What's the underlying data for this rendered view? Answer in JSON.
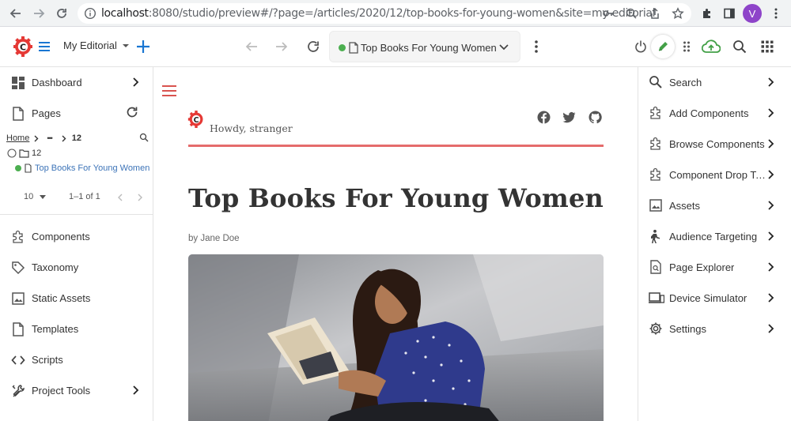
{
  "browser": {
    "url_host": "localhost",
    "url_path": ":8080/studio/preview#/?page=/articles/2020/12/top-books-for-young-women&site=my-editorial",
    "profile_initial": "V",
    "icons": [
      "back-arrow-icon",
      "forward-arrow-icon",
      "refresh-icon",
      "info-icon",
      "key-icon",
      "zoom-icon",
      "share-icon",
      "star-icon",
      "extensions-icon",
      "sidebar-icon"
    ]
  },
  "toolbar": {
    "site_name": "My Editorial",
    "current_page_label": "Top Books For Young Women",
    "status_color": "#4caf50",
    "accent_color": "#1976d2",
    "brand_color": "#e53935"
  },
  "left_nav": {
    "dashboard": "Dashboard",
    "pages": "Pages",
    "breadcrumb": {
      "home": "Home",
      "ellipsis": "•••",
      "current": "12"
    },
    "tree": {
      "folder": "12",
      "page": "Top Books For Young Women"
    },
    "pager": {
      "page_size": "10",
      "range": "1–1 of 1"
    },
    "items": [
      {
        "label": "Components",
        "icon": "puzzle-icon"
      },
      {
        "label": "Taxonomy",
        "icon": "tag-icon"
      },
      {
        "label": "Static Assets",
        "icon": "image-icon"
      },
      {
        "label": "Templates",
        "icon": "file-icon"
      },
      {
        "label": "Scripts",
        "icon": "code-icon"
      },
      {
        "label": "Project Tools",
        "icon": "tools-icon"
      }
    ]
  },
  "preview": {
    "greeting": "Howdy, stranger",
    "title": "Top Books For Young Women",
    "byline": "by Jane Doe",
    "social": [
      "facebook-icon",
      "twitter-icon",
      "github-icon"
    ],
    "accent_color": "#e56b6b"
  },
  "right_panel": {
    "items": [
      {
        "label": "Search",
        "icon": "search-icon"
      },
      {
        "label": "Add Components",
        "icon": "puzzle-icon"
      },
      {
        "label": "Browse Components",
        "icon": "puzzle-icon"
      },
      {
        "label": "Component Drop Targets",
        "icon": "puzzle-icon"
      },
      {
        "label": "Assets",
        "icon": "image-icon"
      },
      {
        "label": "Audience Targeting",
        "icon": "person-icon"
      },
      {
        "label": "Page Explorer",
        "icon": "page-search-icon"
      },
      {
        "label": "Device Simulator",
        "icon": "devices-icon"
      },
      {
        "label": "Settings",
        "icon": "gear-icon"
      }
    ]
  }
}
